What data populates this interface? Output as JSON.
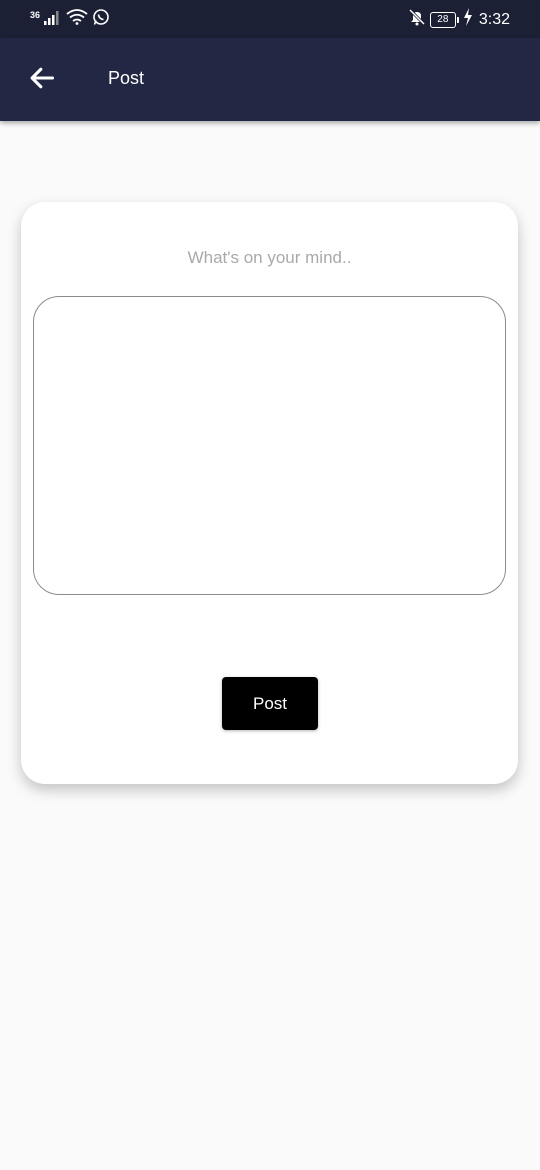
{
  "status_bar": {
    "network_type": "36",
    "battery_level": "28",
    "time": "3:32",
    "icons": [
      "signal-icon",
      "wifi-icon",
      "whatsapp-icon",
      "mute-bell-icon",
      "battery-icon",
      "charging-icon"
    ]
  },
  "app_bar": {
    "title": "Post",
    "back_icon": "arrow-left-icon",
    "background_color": "#222844"
  },
  "composer": {
    "prompt": "What's on your mind..",
    "text_value": "",
    "post_label": "Post"
  }
}
